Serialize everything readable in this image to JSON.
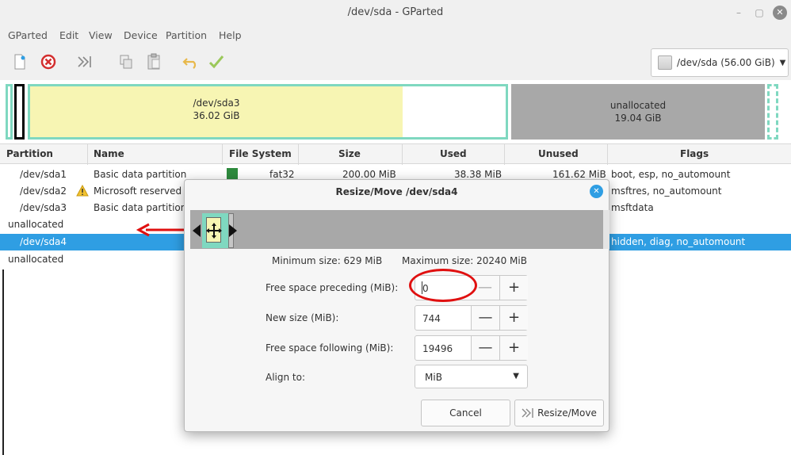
{
  "window": {
    "title": "/dev/sda - GParted"
  },
  "menu": [
    "GParted",
    "Edit",
    "View",
    "Device",
    "Partition",
    "Help"
  ],
  "device": {
    "label": "/dev/sda (56.00 GiB)"
  },
  "diskmap": {
    "sda3": {
      "name": "/dev/sda3",
      "size": "36.02 GiB"
    },
    "unalloc": {
      "name": "unallocated",
      "size": "19.04 GiB"
    }
  },
  "columns": [
    "Partition",
    "Name",
    "File System",
    "Size",
    "Used",
    "Unused",
    "Flags"
  ],
  "rows": [
    {
      "partition": "/dev/sda1",
      "name": "Basic data partition",
      "fs": "fat32",
      "size": "200.00 MiB",
      "used": "38.38 MiB",
      "unused": "161.62 MiB",
      "flags": "boot, esp, no_automount"
    },
    {
      "partition": "/dev/sda2",
      "name": "Microsoft reserved p",
      "flags": "msftres, no_automount"
    },
    {
      "partition": "/dev/sda3",
      "name": "Basic data partition",
      "flags": "msftdata"
    },
    {
      "partition": "unallocated"
    },
    {
      "partition": "/dev/sda4",
      "flags": "hidden, diag, no_automount"
    },
    {
      "partition": "unallocated"
    }
  ],
  "dialog": {
    "title": "Resize/Move /dev/sda4",
    "min_size": "Minimum size: 629 MiB",
    "max_size": "Maximum size: 20240 MiB",
    "preceding_label": "Free space preceding (MiB):",
    "preceding_value": "0",
    "newsize_label": "New size (MiB):",
    "newsize_value": "744",
    "following_label": "Free space following (MiB):",
    "following_value": "19496",
    "align_label": "Align to:",
    "align_value": "MiB",
    "cancel": "Cancel",
    "resize": "Resize/Move"
  }
}
